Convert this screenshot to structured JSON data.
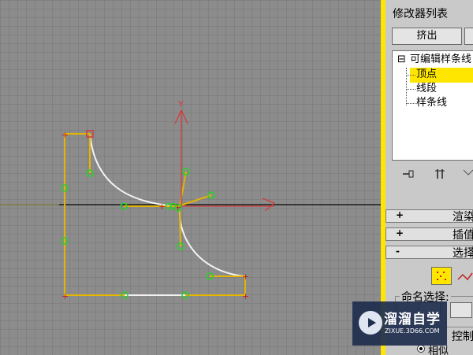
{
  "panel": {
    "modifier_list_label": "修改器列表",
    "extrude_button": "挤出",
    "stack_items": [
      {
        "label": "可编辑样条线",
        "expander": "⊟"
      },
      {
        "label": "顶点",
        "selected": true
      },
      {
        "label": "线段"
      },
      {
        "label": "样条线"
      }
    ],
    "rollouts": [
      {
        "sign": "+",
        "label": "渲染"
      },
      {
        "sign": "+",
        "label": "插值"
      },
      {
        "sign": "-",
        "label": "选择"
      }
    ],
    "named_selection_label": "命名选择:",
    "control_label": "控制",
    "relative_label": "相似"
  },
  "colors": {
    "active_border": "#ffe600",
    "vertex_selection": "#ffe600",
    "spline_yellow": "#e3b400",
    "handle_green": "#29d129",
    "gizmo_red": "#d23c3c"
  },
  "icons": {
    "pin": "pin-stack-icon",
    "show_result": "show-end-result-icon",
    "make_unique": "make-unique-icon",
    "vertex": "vertex-select-icon",
    "segment": "segment-select-icon",
    "play": "play-icon"
  },
  "watermark": {
    "title": "溜溜自学",
    "url": "ZIXUE.3D66.COM"
  }
}
